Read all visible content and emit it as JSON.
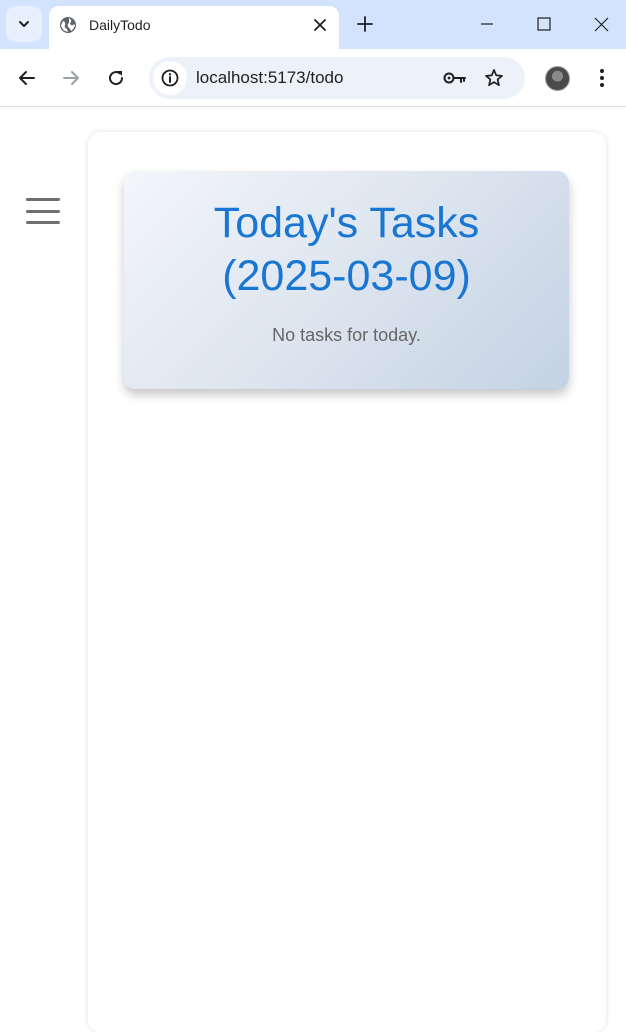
{
  "browser": {
    "tab_title": "DailyTodo",
    "url": "localhost:5173/todo"
  },
  "icons": {
    "tab_search": "chevron-down-icon",
    "favicon": "globe-icon",
    "tab_close": "close-icon",
    "new_tab": "plus-icon",
    "back": "arrow-left-icon",
    "forward": "arrow-right-icon",
    "reload": "reload-icon",
    "site_info": "info-icon",
    "passwords": "key-icon",
    "bookmark": "star-icon",
    "menu": "more-vertical-icon",
    "sidebar_toggle": "hamburger-menu-icon"
  },
  "page": {
    "heading_line1": "Today's Tasks",
    "heading_line2": "(2025-03-09)",
    "empty_message": "No tasks for today."
  },
  "colors": {
    "heading": "#1976d2",
    "muted_text": "#666666",
    "tabstrip": "#d3e3fd"
  }
}
